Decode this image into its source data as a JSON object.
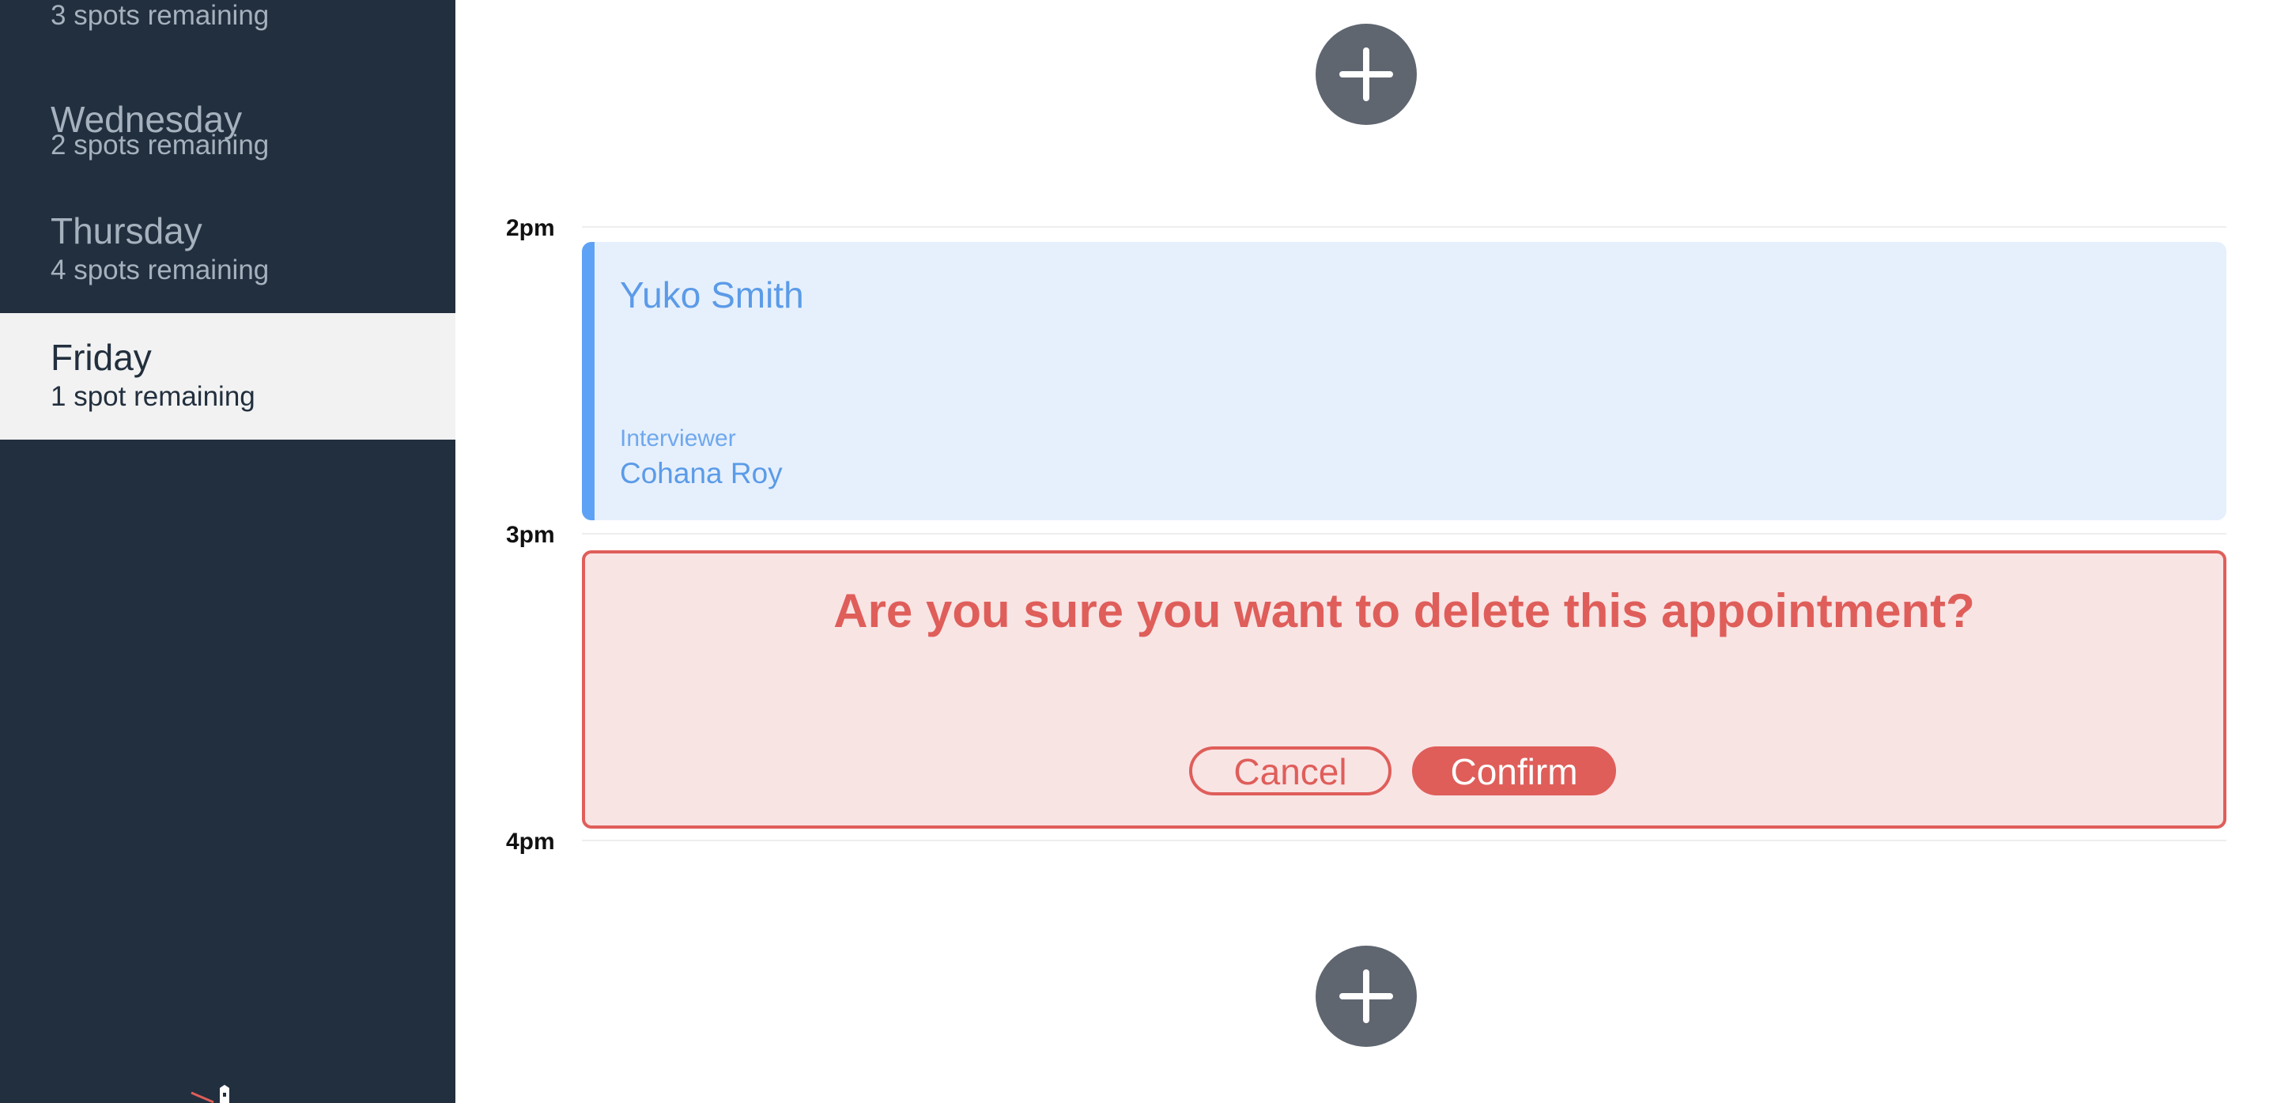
{
  "sidebar": {
    "days": [
      {
        "name": "",
        "spots": "3 spots remaining",
        "selected": false
      },
      {
        "name": "Wednesday",
        "spots": "2 spots remaining",
        "selected": false
      },
      {
        "name": "Thursday",
        "spots": "4 spots remaining",
        "selected": false
      },
      {
        "name": "Friday",
        "spots": "1 spot remaining",
        "selected": true
      }
    ]
  },
  "schedule": {
    "times": [
      "2pm",
      "3pm",
      "4pm"
    ],
    "appointment": {
      "student": "Yuko Smith",
      "interviewer_label": "Interviewer",
      "interviewer_name": "Cohana Roy"
    },
    "confirm": {
      "message": "Are you sure you want to delete this appointment?",
      "cancel_label": "Cancel",
      "confirm_label": "Confirm"
    }
  },
  "colors": {
    "sidebar_bg": "#222f3e",
    "selected_bg": "#f2f2f2",
    "appointment_bg": "#e6f0fc",
    "appointment_accent": "#5ea2f5",
    "danger": "#df5e5a",
    "danger_bg": "#f9e4e4",
    "add_button": "#5f6670"
  },
  "icons": {
    "add": "plus-icon"
  }
}
